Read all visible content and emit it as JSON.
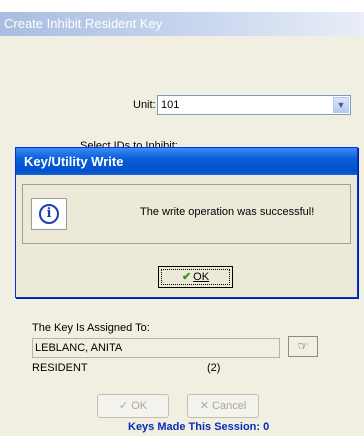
{
  "window": {
    "title": "Create Inhibit Resident Key"
  },
  "form": {
    "unit_label": "Unit:",
    "unit_value": "101",
    "select_ids_label": "Select IDs to Inhibit:",
    "assigned_label": "The Key Is Assigned To:",
    "assigned_name": "LEBLANC, ANITA",
    "assigned_role": "RESIDENT",
    "assigned_count": "(2)",
    "ok_label": "OK",
    "cancel_label": "Cancel",
    "session_text": "Keys Made This Session: 0"
  },
  "dialog": {
    "title": "Key/Utility Write",
    "message": "The write operation was successful!",
    "ok_label": "OK"
  },
  "icons": {
    "info": "info-icon",
    "dropdown": "chevron-down-icon",
    "hand": "hand-pointer-icon",
    "check": "checkmark-icon",
    "cancel": "x-icon"
  }
}
